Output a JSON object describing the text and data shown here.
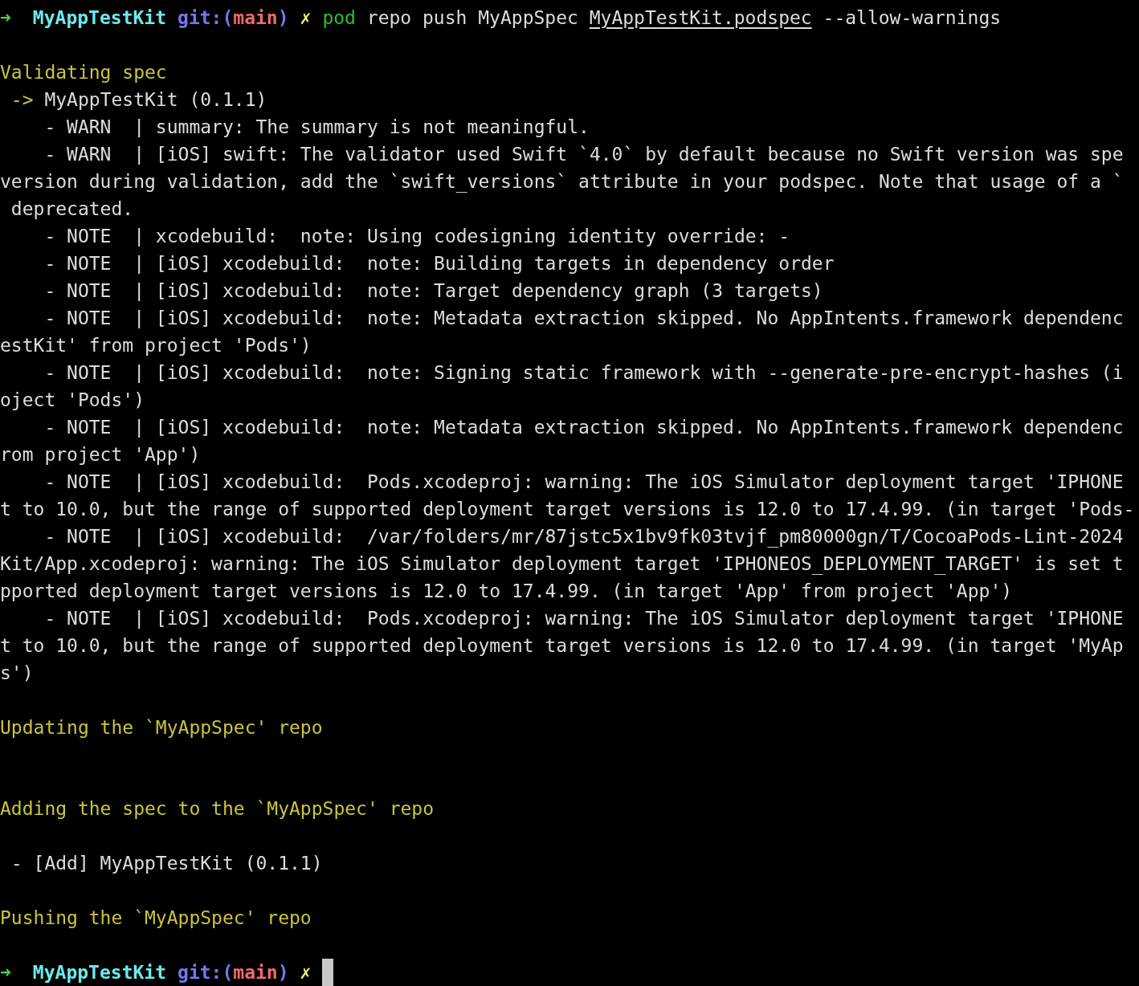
{
  "terminal": {
    "lines": [
      {
        "kind": "prompt",
        "arrow": "➜",
        "directory": "MyAppTestKit",
        "git_prefix": "git:(",
        "branch": "main",
        "git_suffix": ")",
        "dirty_mark": "✗",
        "command": "pod",
        "args": [
          {
            "text": " repo push MyAppSpec ",
            "underlined": false
          },
          {
            "text": "MyAppTestKit.podspec",
            "underlined": true
          },
          {
            "text": " --allow-warnings",
            "underlined": false
          }
        ],
        "cursor": false
      },
      {
        "kind": "blank"
      },
      {
        "kind": "output",
        "segments": [
          {
            "text": "Validating spec",
            "color": "#c9c53c"
          }
        ]
      },
      {
        "kind": "output",
        "segments": [
          {
            "text": " ->",
            "color": "#c9c53c"
          },
          {
            "text": " MyAppTestKit (0.1.1)",
            "color": "#dcdcdc"
          }
        ]
      },
      {
        "kind": "output",
        "segments": [
          {
            "text": "    - WARN  | summary: The summary is not meaningful.",
            "color": "#dcdcdc"
          }
        ]
      },
      {
        "kind": "output",
        "segments": [
          {
            "text": "    - WARN  | [iOS] swift: The validator used Swift `4.0` by default because no Swift version was spe",
            "color": "#dcdcdc"
          }
        ]
      },
      {
        "kind": "output",
        "segments": [
          {
            "text": "version during validation, add the `swift_versions` attribute in your podspec. Note that usage of a `",
            "color": "#dcdcdc"
          }
        ]
      },
      {
        "kind": "output",
        "segments": [
          {
            "text": " deprecated.",
            "color": "#dcdcdc"
          }
        ]
      },
      {
        "kind": "output",
        "segments": [
          {
            "text": "    - NOTE  | xcodebuild:  note: Using codesigning identity override: -",
            "color": "#dcdcdc"
          }
        ]
      },
      {
        "kind": "output",
        "segments": [
          {
            "text": "    - NOTE  | [iOS] xcodebuild:  note: Building targets in dependency order",
            "color": "#dcdcdc"
          }
        ]
      },
      {
        "kind": "output",
        "segments": [
          {
            "text": "    - NOTE  | [iOS] xcodebuild:  note: Target dependency graph (3 targets)",
            "color": "#dcdcdc"
          }
        ]
      },
      {
        "kind": "output",
        "segments": [
          {
            "text": "    - NOTE  | [iOS] xcodebuild:  note: Metadata extraction skipped. No AppIntents.framework dependenc",
            "color": "#dcdcdc"
          }
        ]
      },
      {
        "kind": "output",
        "segments": [
          {
            "text": "estKit' from project 'Pods')",
            "color": "#dcdcdc"
          }
        ]
      },
      {
        "kind": "output",
        "segments": [
          {
            "text": "    - NOTE  | [iOS] xcodebuild:  note: Signing static framework with --generate-pre-encrypt-hashes (i",
            "color": "#dcdcdc"
          }
        ]
      },
      {
        "kind": "output",
        "segments": [
          {
            "text": "oject 'Pods')",
            "color": "#dcdcdc"
          }
        ]
      },
      {
        "kind": "output",
        "segments": [
          {
            "text": "    - NOTE  | [iOS] xcodebuild:  note: Metadata extraction skipped. No AppIntents.framework dependenc",
            "color": "#dcdcdc"
          }
        ]
      },
      {
        "kind": "output",
        "segments": [
          {
            "text": "rom project 'App')",
            "color": "#dcdcdc"
          }
        ]
      },
      {
        "kind": "output",
        "segments": [
          {
            "text": "    - NOTE  | [iOS] xcodebuild:  Pods.xcodeproj: warning: The iOS Simulator deployment target 'IPHONE",
            "color": "#dcdcdc"
          }
        ]
      },
      {
        "kind": "output",
        "segments": [
          {
            "text": "t to 10.0, but the range of supported deployment target versions is 12.0 to 17.4.99. (in target 'Pods-",
            "color": "#dcdcdc"
          }
        ]
      },
      {
        "kind": "output",
        "segments": [
          {
            "text": "    - NOTE  | [iOS] xcodebuild:  /var/folders/mr/87jstc5x1bv9fk03tvjf_pm80000gn/T/CocoaPods-Lint-2024",
            "color": "#dcdcdc"
          }
        ]
      },
      {
        "kind": "output",
        "segments": [
          {
            "text": "Kit/App.xcodeproj: warning: The iOS Simulator deployment target 'IPHONEOS_DEPLOYMENT_TARGET' is set t",
            "color": "#dcdcdc"
          }
        ]
      },
      {
        "kind": "output",
        "segments": [
          {
            "text": "pported deployment target versions is 12.0 to 17.4.99. (in target 'App' from project 'App')",
            "color": "#dcdcdc"
          }
        ]
      },
      {
        "kind": "output",
        "segments": [
          {
            "text": "    - NOTE  | [iOS] xcodebuild:  Pods.xcodeproj: warning: The iOS Simulator deployment target 'IPHONE",
            "color": "#dcdcdc"
          }
        ]
      },
      {
        "kind": "output",
        "segments": [
          {
            "text": "t to 10.0, but the range of supported deployment target versions is 12.0 to 17.4.99. (in target 'MyAp",
            "color": "#dcdcdc"
          }
        ]
      },
      {
        "kind": "output",
        "segments": [
          {
            "text": "s')",
            "color": "#dcdcdc"
          }
        ]
      },
      {
        "kind": "blank"
      },
      {
        "kind": "output",
        "segments": [
          {
            "text": "Updating the `MyAppSpec' repo",
            "color": "#c9c53c"
          }
        ]
      },
      {
        "kind": "blank"
      },
      {
        "kind": "blank"
      },
      {
        "kind": "output",
        "segments": [
          {
            "text": "Adding the spec to the `MyAppSpec' repo",
            "color": "#c9c53c"
          }
        ]
      },
      {
        "kind": "blank"
      },
      {
        "kind": "output",
        "segments": [
          {
            "text": " - [Add] MyAppTestKit (0.1.1)",
            "color": "#dcdcdc"
          }
        ]
      },
      {
        "kind": "blank"
      },
      {
        "kind": "output",
        "segments": [
          {
            "text": "Pushing the `MyAppSpec' repo",
            "color": "#c9c53c"
          }
        ]
      },
      {
        "kind": "blank"
      },
      {
        "kind": "prompt",
        "arrow": "➜",
        "directory": "MyAppTestKit",
        "git_prefix": "git:(",
        "branch": "main",
        "git_suffix": ")",
        "dirty_mark": "✗",
        "cursor": true
      }
    ]
  }
}
